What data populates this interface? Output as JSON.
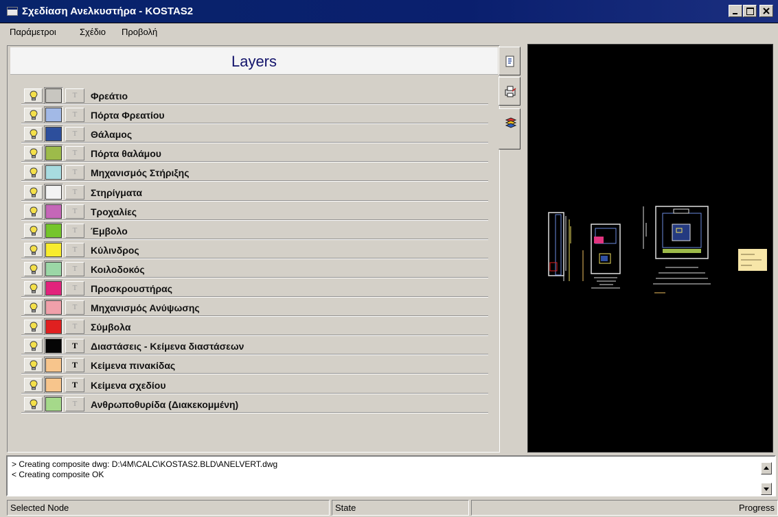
{
  "window": {
    "title": "Σχεδίαση Ανελκυστήρα - KOSTAS2",
    "controls": [
      "minimize",
      "maximize",
      "close"
    ]
  },
  "menu": [
    "Παράμετροι",
    "Σχέδιο",
    "Προβολή"
  ],
  "layers_panel": {
    "title": "Layers",
    "items": [
      {
        "name": "Φρεάτιο",
        "color": "#c8c6c0",
        "text_enabled": false
      },
      {
        "name": "Πόρτα Φρεατίου",
        "color": "#a2b9e6",
        "text_enabled": false
      },
      {
        "name": "Θάλαμος",
        "color": "#2d4f9c",
        "text_enabled": false
      },
      {
        "name": "Πόρτα θαλάμου",
        "color": "#9dbb4a",
        "text_enabled": false
      },
      {
        "name": "Μηχανισμός Στήριξης",
        "color": "#a8dbe0",
        "text_enabled": false
      },
      {
        "name": "Στηρίγματα",
        "color": "#f3f3f3",
        "text_enabled": false
      },
      {
        "name": "Τροχαλίες",
        "color": "#c567b8",
        "text_enabled": false
      },
      {
        "name": "Έμβολο",
        "color": "#75c52b",
        "text_enabled": false
      },
      {
        "name": "Κύλινδρος",
        "color": "#f8ec2d",
        "text_enabled": false
      },
      {
        "name": "Κοιλοδοκός",
        "color": "#9bd7a6",
        "text_enabled": false
      },
      {
        "name": "Προσκρουστήρας",
        "color": "#e2237c",
        "text_enabled": false
      },
      {
        "name": "Μηχανισμός Ανύψωσης",
        "color": "#f0a0aa",
        "text_enabled": false
      },
      {
        "name": "Σύμβολα",
        "color": "#e02020",
        "text_enabled": false
      },
      {
        "name": "Διαστάσεις - Κείμενα διαστάσεων",
        "color": "#050505",
        "text_enabled": true
      },
      {
        "name": "Κείμενα πινακίδας",
        "color": "#f7c58c",
        "text_enabled": true
      },
      {
        "name": "Κείμενα σχεδίου",
        "color": "#f7c58c",
        "text_enabled": true
      },
      {
        "name": "Ανθρωποθυρίδα (Διακεκομμένη)",
        "color": "#a5d98a",
        "text_enabled": false
      }
    ]
  },
  "tabs": [
    "document-icon",
    "print-icon",
    "layers-icon"
  ],
  "log": [
    "> Creating composite dwg: D:\\4M\\CALC\\KOSTAS2.BLD\\ANELVERT.dwg",
    "< Creating composite OK"
  ],
  "status": {
    "node": "Selected Node",
    "state": "State",
    "progress": "Progress"
  },
  "colors": {
    "titlebar": "#0a246a",
    "panel": "#d4d0c8",
    "preview_bg": "#000000",
    "layers_title": "#12136b"
  }
}
